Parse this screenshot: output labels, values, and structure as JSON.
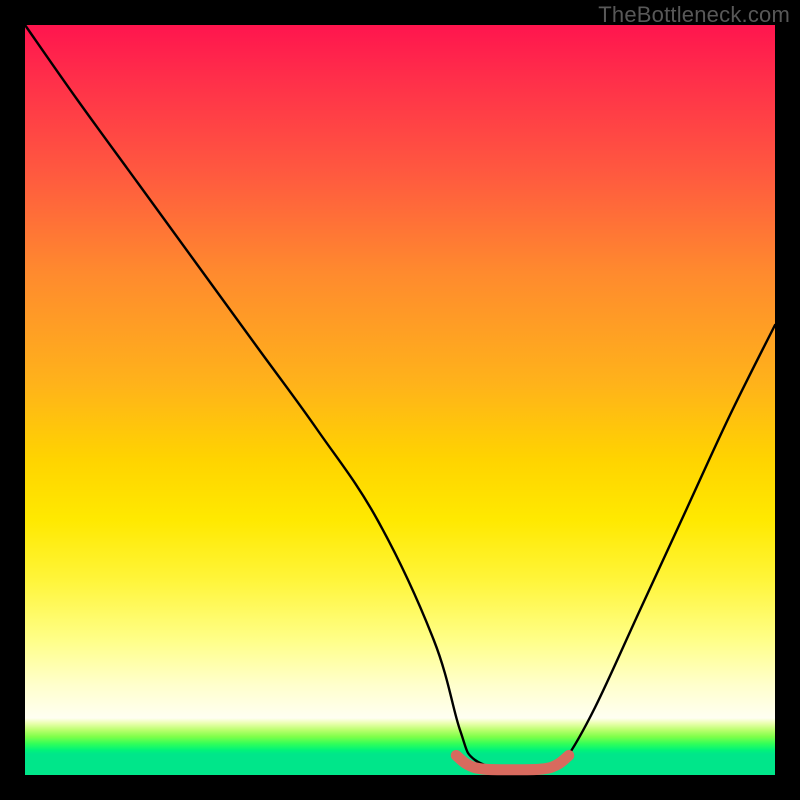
{
  "watermark": "TheBottleneck.com",
  "chart_data": {
    "type": "line",
    "title": "",
    "xlabel": "",
    "ylabel": "",
    "xlim": [
      0,
      100
    ],
    "ylim": [
      0,
      100
    ],
    "grid": false,
    "legend": false,
    "series": [
      {
        "name": "bottleneck-curve",
        "color": "#000000",
        "x": [
          0,
          7,
          15,
          23,
          31,
          39,
          47,
          54.5,
          58,
          60,
          65,
          70,
          72,
          76,
          82,
          88,
          94,
          100
        ],
        "values": [
          100,
          90,
          79,
          68,
          57,
          46,
          34,
          18,
          6,
          2,
          0.7,
          0.7,
          2,
          9,
          22,
          35,
          48,
          60
        ]
      },
      {
        "name": "valley-marker",
        "color": "#d86a5e",
        "x": [
          57.5,
          59,
          61,
          65,
          69,
          71,
          72.5
        ],
        "values": [
          2.6,
          1.4,
          0.8,
          0.7,
          0.8,
          1.4,
          2.6
        ]
      }
    ],
    "gradient_stops": [
      {
        "offset": 0.0,
        "color": "#ff154e"
      },
      {
        "offset": 0.07,
        "color": "#ff2e4a"
      },
      {
        "offset": 0.2,
        "color": "#ff5a3f"
      },
      {
        "offset": 0.33,
        "color": "#ff8a2e"
      },
      {
        "offset": 0.48,
        "color": "#ffb31a"
      },
      {
        "offset": 0.58,
        "color": "#ffd400"
      },
      {
        "offset": 0.66,
        "color": "#ffe900"
      },
      {
        "offset": 0.74,
        "color": "#fff53a"
      },
      {
        "offset": 0.82,
        "color": "#ffff88"
      },
      {
        "offset": 0.88,
        "color": "#ffffcc"
      },
      {
        "offset": 0.924,
        "color": "#fffff2"
      },
      {
        "offset": 0.931,
        "color": "#ebffb0"
      },
      {
        "offset": 0.94,
        "color": "#baff6e"
      },
      {
        "offset": 0.949,
        "color": "#7fff4a"
      },
      {
        "offset": 0.958,
        "color": "#34ff58"
      },
      {
        "offset": 0.967,
        "color": "#00f37a"
      },
      {
        "offset": 0.972,
        "color": "#00e68a"
      },
      {
        "offset": 1.0,
        "color": "#00e68a"
      }
    ]
  }
}
